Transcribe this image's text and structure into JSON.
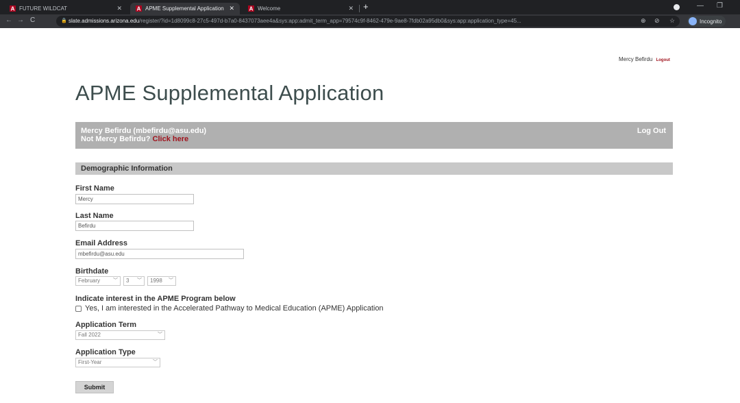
{
  "browser": {
    "tabs": [
      {
        "title": "FUTURE WILDCAT"
      },
      {
        "title": "APME Supplemental Application"
      },
      {
        "title": "Welcome"
      }
    ],
    "url_host": "slate.admissions.arizona.edu",
    "url_path": "/register/?id=1d8099c8-27c5-497d-b7a0-8437073aee4a&sys:app:admit_term_app=79574c9f-8462-479e-9ae8-7fdb02a95db0&sys:app:application_type=45...",
    "incognito_label": "Incognito"
  },
  "header": {
    "user_name": "Mercy Befirdu",
    "logout_label": "Logout"
  },
  "page": {
    "title": "APME Supplemental Application"
  },
  "userbox": {
    "identity": "Mercy Befirdu (mbefirdu@asu.edu)",
    "not_user_prefix": "Not Mercy Befirdu?",
    "click_here": "Click here",
    "logout_label": "Log Out"
  },
  "form": {
    "section_title": "Demographic Information",
    "first_name": {
      "label": "First Name",
      "value": "Mercy"
    },
    "last_name": {
      "label": "Last Name",
      "value": "Befirdu"
    },
    "email": {
      "label": "Email Address",
      "value": "mbefirdu@asu.edu"
    },
    "birthdate": {
      "label": "Birthdate",
      "month": "February",
      "day": "3",
      "year": "1998"
    },
    "interest": {
      "label": "Indicate interest in the APME Program below",
      "option": "Yes, I am interested in the Accelerated Pathway to Medical Education (APME) Application"
    },
    "term": {
      "label": "Application Term",
      "value": "Fall 2022"
    },
    "type": {
      "label": "Application Type",
      "value": "First-Year"
    },
    "submit_label": "Submit"
  },
  "colors": {
    "accent_red": "#a0141e",
    "title_color": "#3d4d4d",
    "userbox_bg": "#b0b0b0",
    "section_bg": "#c8c8c8"
  }
}
